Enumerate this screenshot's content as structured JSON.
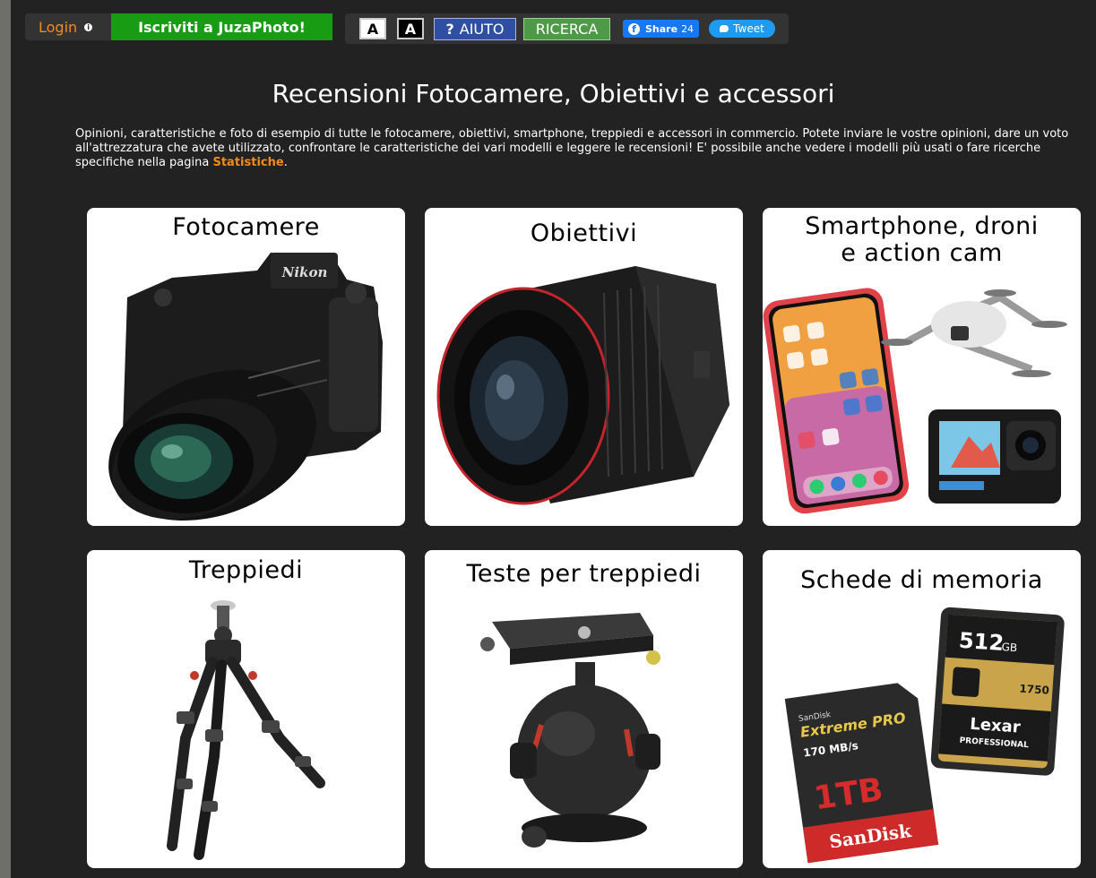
{
  "topbar": {
    "login_label": "Login",
    "signup_label": "Iscriviti a JuzaPhoto!",
    "font_small_label": "A",
    "font_large_label": "A",
    "help_label": "AIUTO",
    "help_icon": "?",
    "search_label": "RICERCA",
    "share_label": "Share",
    "share_count": "24",
    "tweet_label": "Tweet"
  },
  "page": {
    "title": "Recensioni Fotocamere, Obiettivi e accessori",
    "intro_text": "Opinioni, caratteristiche e foto di esempio di tutte le fotocamere, obiettivi, smartphone, treppiedi e accessori in commercio. Potete inviare le vostre opinioni, dare un voto all'attrezzatura che avete utilizzato, confrontare le caratteristiche dei vari modelli e leggere le recensioni! E' possibile anche vedere i modelli più usati o fare ricerche specifiche nella pagina ",
    "intro_link": "Statistiche",
    "intro_end": "."
  },
  "categories": [
    {
      "title": "Fotocamere",
      "icon": "camera-image"
    },
    {
      "title": "Obiettivi",
      "icon": "lens-image"
    },
    {
      "title_line1": "Smartphone, droni",
      "title_line2": "e action cam",
      "icon": "smartphone-drone-actioncam-image"
    },
    {
      "title": "Treppiedi",
      "icon": "tripod-image"
    },
    {
      "title": "Teste per treppiedi",
      "icon": "tripod-head-image"
    },
    {
      "title": "Schede di memoria",
      "icon": "memory-cards-image"
    }
  ],
  "product_labels": {
    "camera_brand": "Nikon",
    "card_sd_brand": "SanDisk",
    "card_sd_line": "Extreme PRO",
    "card_sd_speed": "170 MB/s",
    "card_sd_capacity": "1TB",
    "card_cf_capacity": "512",
    "card_cf_unit": "GB",
    "card_cf_speed": "1750",
    "card_cf_brand": "Lexar",
    "card_cf_line": "PROFESSIONAL"
  },
  "colors": {
    "page_bg": "#222222",
    "outer_bg": "#6f6f69",
    "accent_orange": "#f28b1c",
    "signup_green": "#179c14",
    "help_blue": "#2f4fa2",
    "search_green": "#4f9a48"
  }
}
